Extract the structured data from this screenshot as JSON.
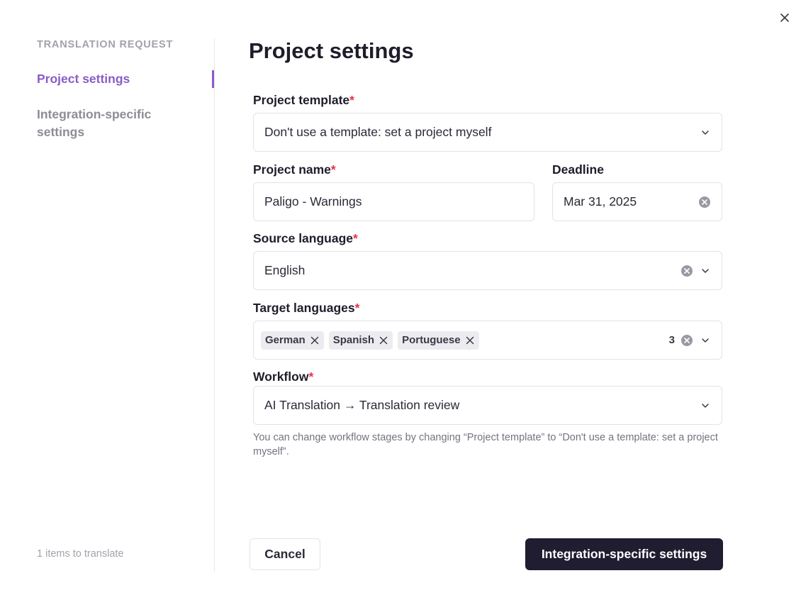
{
  "sidebar": {
    "heading": "TRANSLATION REQUEST",
    "items": [
      {
        "label": "Project settings",
        "active": true
      },
      {
        "label": "Integration-specific settings",
        "active": false
      }
    ],
    "footer": "1 items to translate"
  },
  "main": {
    "title": "Project settings",
    "fields": {
      "project_template": {
        "label": "Project template",
        "required_mark": "*",
        "value": "Don't use a template: set a project myself"
      },
      "project_name": {
        "label": "Project name",
        "required_mark": "*",
        "value": "Paligo - Warnings"
      },
      "deadline": {
        "label": "Deadline",
        "value": "Mar 31, 2025"
      },
      "source_language": {
        "label": "Source language",
        "required_mark": "*",
        "value": "English"
      },
      "target_languages": {
        "label": "Target languages",
        "required_mark": "*",
        "tags": [
          "German",
          "Spanish",
          "Portuguese"
        ],
        "count": "3"
      },
      "workflow": {
        "label": "Workflow",
        "required_mark": "*",
        "value": "AI Translation → Translation review"
      }
    },
    "hint": "You can change workflow stages by changing “Project template” to “Don't use a template: set a project myself”."
  },
  "footer": {
    "cancel_label": "Cancel",
    "next_label": "Integration-specific settings"
  },
  "icons": {
    "close": "close-icon",
    "clear": "clear-circle-icon",
    "chevron": "chevron-down-icon",
    "tag_remove": "tag-remove-icon"
  },
  "colors": {
    "accent": "#8a5cc7",
    "required": "#e5334b",
    "primary_button": "#211d30",
    "muted_text": "#a3a2ab"
  }
}
